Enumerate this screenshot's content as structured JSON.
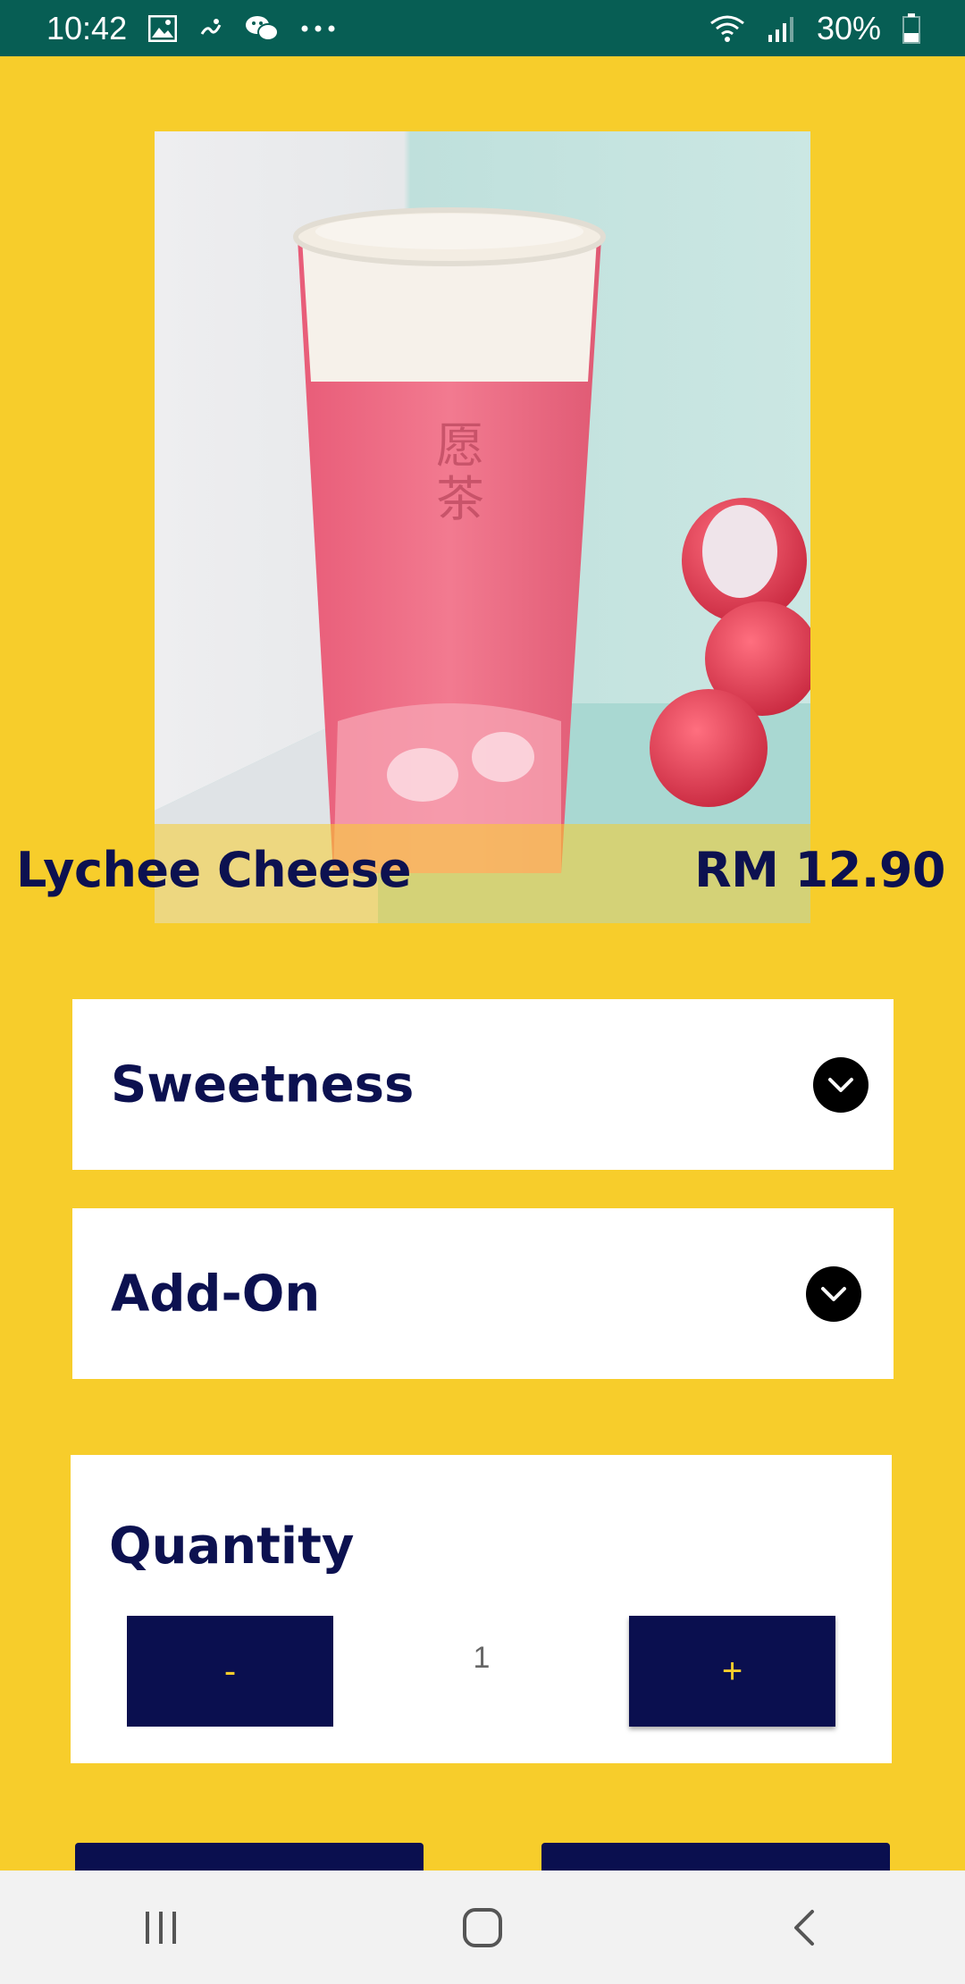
{
  "status_bar": {
    "time": "10:42",
    "battery": "30%",
    "icons_left": [
      "image-icon",
      "app-notification-icon",
      "wechat-icon",
      "more-dots-icon"
    ],
    "icons_right": [
      "wifi-icon",
      "signal-icon",
      "battery-icon"
    ]
  },
  "product": {
    "name": "Lychee Cheese",
    "price": "RM 12.90",
    "image": "lychee-cheese-drink-photo"
  },
  "options": {
    "sweetness_label": "Sweetness",
    "addon_label": "Add-On"
  },
  "quantity": {
    "label": "Quantity",
    "minus_label": "-",
    "plus_label": "+",
    "value": "1"
  },
  "colors": {
    "background": "#F7CD2B",
    "navy": "#0C1150",
    "status_bar": "#075E54"
  },
  "nav": {
    "icons": [
      "recent-apps-icon",
      "home-icon",
      "back-icon"
    ]
  }
}
